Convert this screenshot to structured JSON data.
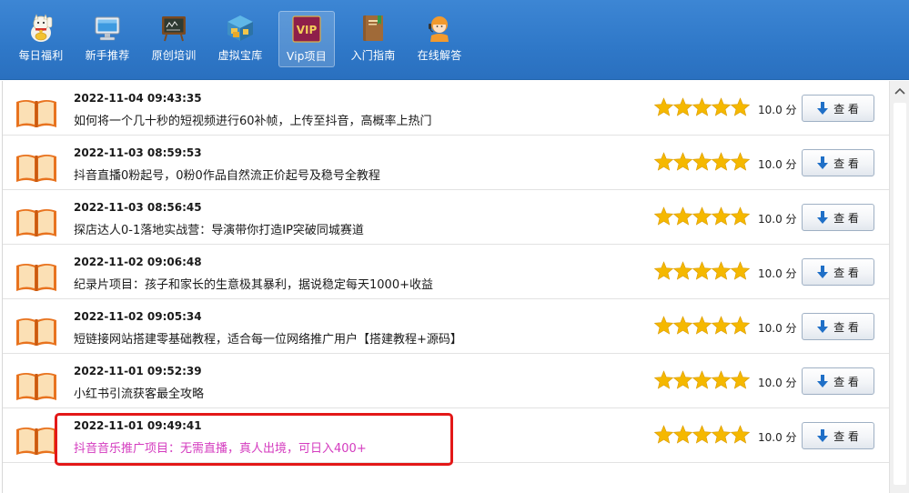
{
  "toolbar": {
    "items": [
      {
        "label": "每日福利",
        "icon": "lucky-cat-icon"
      },
      {
        "label": "新手推荐",
        "icon": "monitor-icon"
      },
      {
        "label": "原创培训",
        "icon": "blackboard-icon"
      },
      {
        "label": "虚拟宝库",
        "icon": "warehouse-icon"
      },
      {
        "label": "Vip项目",
        "icon": "vip-badge-icon",
        "badge_text": "VIP",
        "active": true
      },
      {
        "label": "入门指南",
        "icon": "guide-book-icon"
      },
      {
        "label": "在线解答",
        "icon": "support-agent-icon"
      }
    ]
  },
  "list": {
    "rows": [
      {
        "date": "2022-11-04 09:43:35",
        "title": "如何将一个几十秒的短视频进行60补帧，上传至抖音，高概率上热门",
        "rating": 5,
        "score": "10.0 分",
        "button": "查 看"
      },
      {
        "date": "2022-11-03 08:59:53",
        "title": "抖音直播0粉起号，0粉0作品自然流正价起号及稳号全教程",
        "rating": 5,
        "score": "10.0 分",
        "button": "查 看"
      },
      {
        "date": "2022-11-03 08:56:45",
        "title": "探店达人0-1落地实战营：导演带你打造IP突破同城赛道",
        "rating": 5,
        "score": "10.0 分",
        "button": "查 看"
      },
      {
        "date": "2022-11-02 09:06:48",
        "title": "纪录片项目：孩子和家长的生意极其暴利，据说稳定每天1000+收益",
        "rating": 5,
        "score": "10.0 分",
        "button": "查 看"
      },
      {
        "date": "2022-11-02 09:05:34",
        "title": "短链接网站搭建零基础教程，适合每一位网络推广用户【搭建教程+源码】",
        "rating": 5,
        "score": "10.0 分",
        "button": "查 看"
      },
      {
        "date": "2022-11-01 09:52:39",
        "title": "小红书引流获客最全攻略",
        "rating": 5,
        "score": "10.0 分",
        "button": "查 看"
      },
      {
        "date": "2022-11-01 09:49:41",
        "title": "抖音音乐推广项目：无需直播，真人出境，可日入400+",
        "rating": 5,
        "score": "10.0 分",
        "button": "查 看",
        "highlighted": true
      }
    ]
  },
  "colors": {
    "toolbar_bg": "#2f78c8",
    "star": "#f5b800",
    "highlight_border": "#e31818",
    "highlight_text": "#d43bbf",
    "book": "#e8731f"
  }
}
